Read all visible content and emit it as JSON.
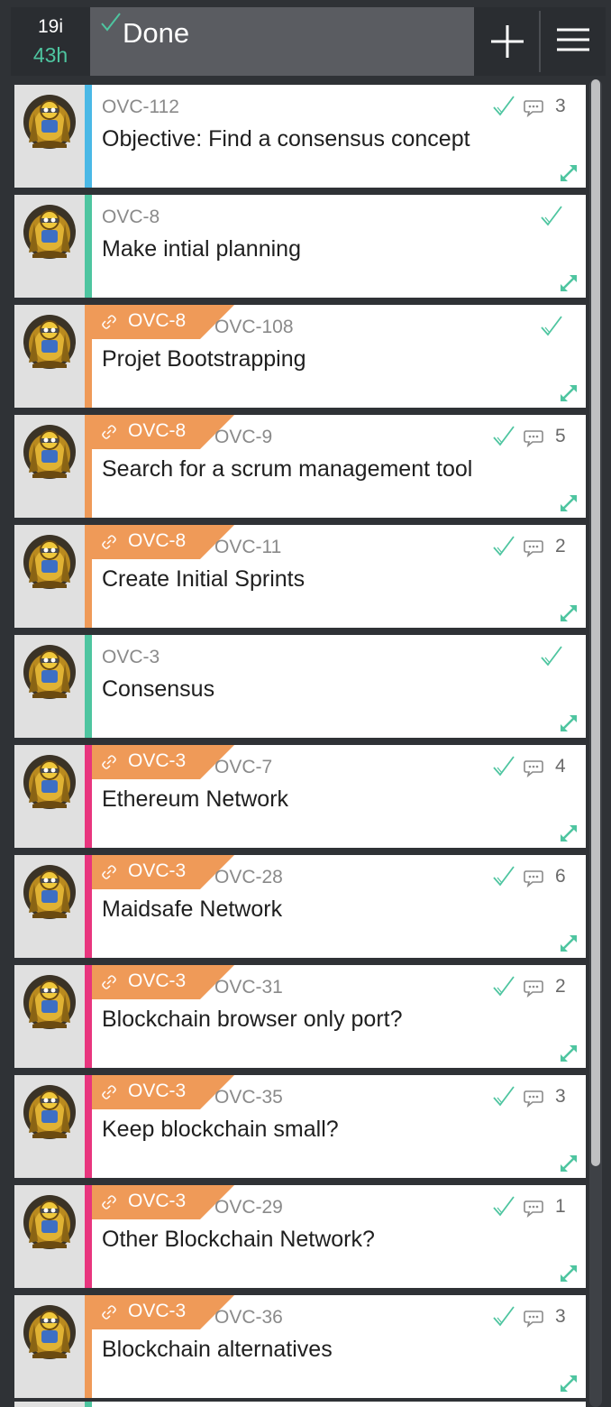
{
  "header": {
    "item_count": "19i",
    "hours": "43h",
    "column_title": "Done",
    "check_icon": "check-icon",
    "add_icon": "plus-icon",
    "menu_icon": "hamburger-menu-icon"
  },
  "colors": {
    "accent_green": "#4ec5a0",
    "tag_orange": "#ef9a58",
    "accent_blue": "#4ab8e6",
    "accent_pink": "#e8357e",
    "header_bg": "#2a2d31",
    "title_bg": "#5a5c61"
  },
  "cards": [
    {
      "key": "OVC-112",
      "title": "Objective: Find a consensus concept",
      "parent": "",
      "accent": "#4ab8e6",
      "comments": "3",
      "done": true
    },
    {
      "key": "OVC-8",
      "title": "Make intial planning",
      "parent": "",
      "accent": "#4ec5a0",
      "comments": "",
      "done": true
    },
    {
      "key": "OVC-108",
      "title": "Projet Bootstrapping",
      "parent": "OVC-8",
      "accent": "#ef9a58",
      "comments": "",
      "done": true
    },
    {
      "key": "OVC-9",
      "title": "Search for a scrum management tool",
      "parent": "OVC-8",
      "accent": "#ef9a58",
      "comments": "5",
      "done": true
    },
    {
      "key": "OVC-11",
      "title": "Create Initial Sprints",
      "parent": "OVC-8",
      "accent": "#ef9a58",
      "comments": "2",
      "done": true
    },
    {
      "key": "OVC-3",
      "title": "Consensus",
      "parent": "",
      "accent": "#4ec5a0",
      "comments": "",
      "done": true
    },
    {
      "key": "OVC-7",
      "title": "Ethereum Network",
      "parent": "OVC-3",
      "accent": "#e8357e",
      "comments": "4",
      "done": true
    },
    {
      "key": "OVC-28",
      "title": "Maidsafe Network",
      "parent": "OVC-3",
      "accent": "#e8357e",
      "comments": "6",
      "done": true
    },
    {
      "key": "OVC-31",
      "title": "Blockchain browser only port?",
      "parent": "OVC-3",
      "accent": "#e8357e",
      "comments": "2",
      "done": true
    },
    {
      "key": "OVC-35",
      "title": "Keep blockchain small?",
      "parent": "OVC-3",
      "accent": "#e8357e",
      "comments": "3",
      "done": true
    },
    {
      "key": "OVC-29",
      "title": "Other Blockchain Network?",
      "parent": "OVC-3",
      "accent": "#e8357e",
      "comments": "1",
      "done": true
    },
    {
      "key": "OVC-36",
      "title": "Blockchain alternatives",
      "parent": "OVC-3",
      "accent": "#ef9a58",
      "comments": "3",
      "done": true
    }
  ]
}
